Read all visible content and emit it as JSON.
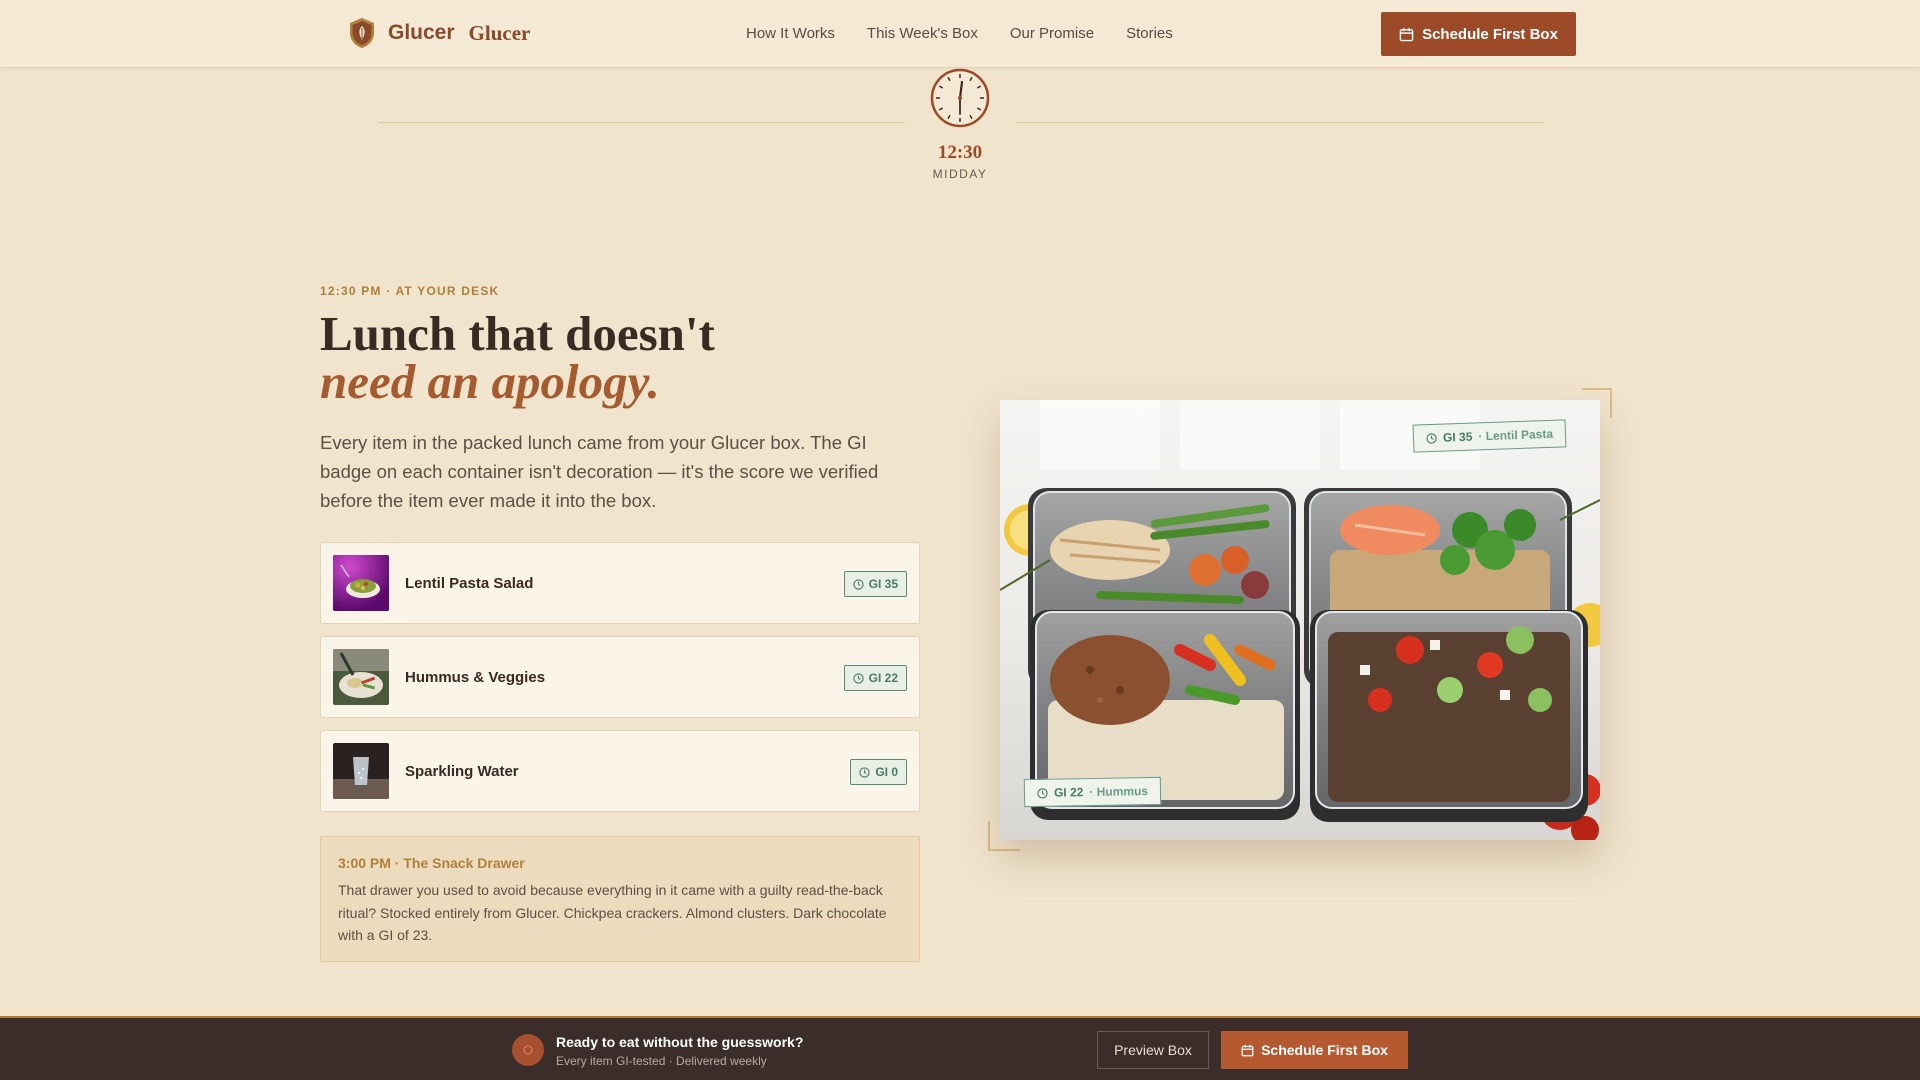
{
  "nav": {
    "brand_primary": "Glucer",
    "brand_secondary": "Glucer",
    "links": [
      "How It Works",
      "This Week's Box",
      "Our Promise",
      "Stories"
    ],
    "cta_label": "Schedule First Box"
  },
  "clock": {
    "time": "12:30",
    "label": "MIDDAY"
  },
  "hero": {
    "eyebrow": "12:30 PM · AT YOUR DESK",
    "headline_line1": "Lunch that doesn't",
    "headline_line2": "need an apology.",
    "lede": "Every item in the packed lunch came from your Glucer box. The GI badge on each container isn't decoration — it's the score we verified before the item ever made it into the box."
  },
  "items": [
    {
      "name": "Lentil Pasta Salad",
      "gi": "GI 35",
      "thumb_color": "#8a2a8a"
    },
    {
      "name": "Hummus & Veggies",
      "gi": "GI 22",
      "thumb_color": "#6a7a5a"
    },
    {
      "name": "Sparkling Water",
      "gi": "GI 0",
      "thumb_color": "#2a2422"
    }
  ],
  "snack": {
    "title": "3:00 PM · The Snack Drawer",
    "body": "That drawer you used to avoid because everything in it came with a guilty read-the-back ritual? Stocked entirely from Glucer. Chickpea crackers. Almond clusters. Dark chocolate with a GI of 23."
  },
  "photo": {
    "tag_top_score": "GI 35",
    "tag_top_label": "· Lentil Pasta",
    "tag_bottom_score": "GI 22",
    "tag_bottom_label": "· Hummus"
  },
  "bottom_bar": {
    "title": "Ready to eat without the guesswork?",
    "subtitle": "Every item GI-tested · Delivered weekly",
    "preview_label": "Preview Box",
    "cta_label": "Schedule First Box"
  },
  "colors": {
    "accent": "#9c4a28",
    "gold": "#b0803a",
    "badge_green": "#4a7a6a",
    "background": "#f1e4cc"
  }
}
